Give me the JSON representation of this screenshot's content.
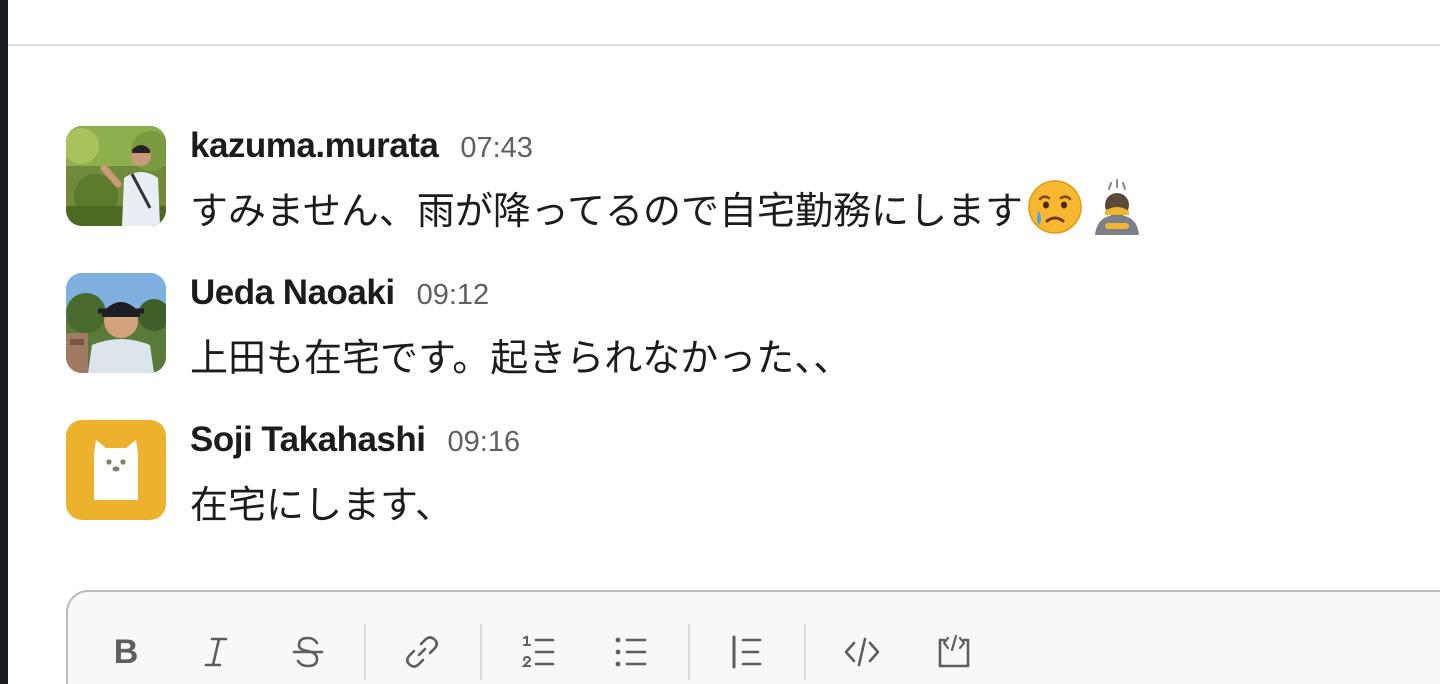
{
  "messages": [
    {
      "sender": "kazuma.murata",
      "time": "07:43",
      "text": "すみません、雨が降ってるので自宅勤務にします",
      "emojis": [
        "crying-face-emoji",
        "bowing-person-emoji"
      ]
    },
    {
      "sender": "Ueda Naoaki",
      "time": "09:12",
      "text": "上田も在宅です。起きられなかった、、"
    },
    {
      "sender": "Soji Takahashi",
      "time": "09:16",
      "text": "在宅にします、"
    }
  ],
  "composer": {
    "tools": [
      "bold-icon",
      "italic-icon",
      "strikethrough-icon",
      "link-icon",
      "numbered-list-icon",
      "bulleted-list-icon",
      "blockquote-icon",
      "code-icon",
      "code-block-icon"
    ]
  },
  "colors": {
    "text": "#1d1c1d",
    "timestamp": "#616061",
    "icon": "#5e5d60",
    "avatar_soji_bg": "#ecb22e",
    "sidebar": "#1a1d21"
  }
}
